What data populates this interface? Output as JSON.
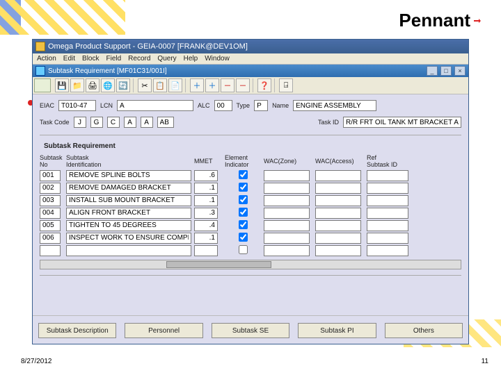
{
  "brand": "Pennant",
  "footer": {
    "date": "8/27/2012",
    "page": "11"
  },
  "window": {
    "title": "Omega Product Support - GEIA-0007 [FRANK@DEV1OM]",
    "menus": [
      "Action",
      "Edit",
      "Block",
      "Field",
      "Record",
      "Query",
      "Help",
      "Window"
    ],
    "child_title": "Subtask Requirement  [MF01C31/001I]"
  },
  "toolbar": {
    "groups": [
      [
        "save",
        "folder",
        "print",
        "globe",
        "refresh"
      ],
      [
        "cut",
        "copy",
        "paste"
      ],
      [
        "add",
        "add",
        "remove",
        "remove"
      ],
      [
        "help"
      ],
      [
        "exit"
      ]
    ],
    "icons": {
      "save": "💾",
      "folder": "📁",
      "print": "🖨",
      "globe": "🌐",
      "refresh": "🔄",
      "cut": "✂",
      "copy": "📋",
      "paste": "📄",
      "add": "＋",
      "remove": "－",
      "help": "❓",
      "exit": "⍈"
    }
  },
  "header": {
    "eiac_lbl": "EIAC",
    "eiac": "T010-47",
    "lcn_lbl": "LCN",
    "lcn": "A",
    "alc_lbl": "ALC",
    "alc": "00",
    "type_lbl": "Type",
    "type": "P",
    "name_lbl": "Name",
    "name": "ENGINE ASSEMBLY",
    "taskcode_lbl": "Task Code",
    "taskcode": [
      "J",
      "G",
      "C",
      "A",
      "A",
      "AB"
    ],
    "taskid_lbl": "Task ID",
    "taskid": "R/R FRT OIL TANK MT BRACKET ASSY"
  },
  "section_title": "Subtask Requirement",
  "columns": {
    "no": "Subtask\nNo",
    "ident": "Subtask\nIdentification",
    "mmet": "MMET",
    "elem": "Element\nIndicator",
    "zone": "WAC(Zone)",
    "access": "WAC(Access)",
    "ref": "Ref\nSubtask ID"
  },
  "rows": [
    {
      "no": "001",
      "ident": "REMOVE SPLINE BOLTS",
      "mmet": ".6",
      "elem": true,
      "zone": "",
      "access": "",
      "ref": ""
    },
    {
      "no": "002",
      "ident": "REMOVE DAMAGED BRACKET",
      "mmet": ".1",
      "elem": true,
      "zone": "",
      "access": "",
      "ref": ""
    },
    {
      "no": "003",
      "ident": "INSTALL SUB MOUNT BRACKET",
      "mmet": ".1",
      "elem": true,
      "zone": "",
      "access": "",
      "ref": ""
    },
    {
      "no": "004",
      "ident": "ALIGN FRONT BRACKET",
      "mmet": ".3",
      "elem": true,
      "zone": "",
      "access": "",
      "ref": ""
    },
    {
      "no": "005",
      "ident": "TIGHTEN TO 45 DEGREES",
      "mmet": ".4",
      "elem": true,
      "zone": "",
      "access": "",
      "ref": ""
    },
    {
      "no": "006",
      "ident": "INSPECT WORK TO ENSURE COMPLETION",
      "mmet": ".1",
      "elem": true,
      "zone": "",
      "access": "",
      "ref": ""
    },
    {
      "no": "",
      "ident": "",
      "mmet": "",
      "elem": false,
      "zone": "",
      "access": "",
      "ref": ""
    }
  ],
  "buttons": {
    "desc": "Subtask Description",
    "personnel": "Personnel",
    "se": "Subtask SE",
    "pi": "Subtask PI",
    "others": "Others"
  }
}
